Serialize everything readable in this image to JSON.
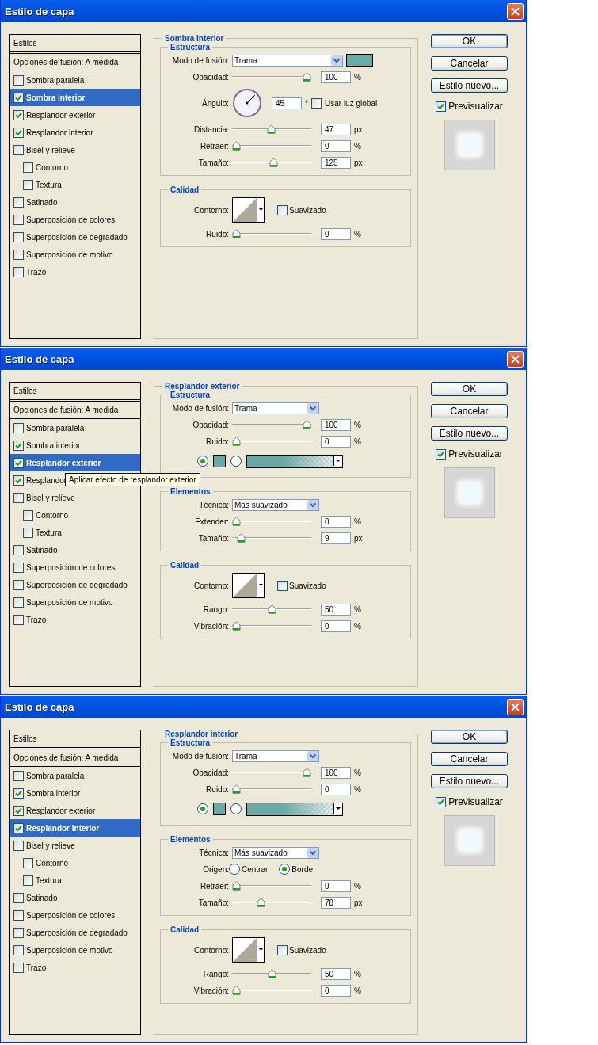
{
  "dialogs": [
    {
      "title": "Estilo de capa",
      "styles_header": "Estilos",
      "blend_options": "Opciones de fusión: A medida",
      "styles": [
        {
          "label": "Sombra paralela",
          "checked": false,
          "selected": false
        },
        {
          "label": "Sombra interior",
          "checked": true,
          "selected": true
        },
        {
          "label": "Resplandor exterior",
          "checked": true,
          "selected": false
        },
        {
          "label": "Resplandor interior",
          "checked": true,
          "selected": false
        },
        {
          "label": "Bisel y relieve",
          "checked": false,
          "selected": false,
          "children": [
            {
              "label": "Contorno",
              "checked": false,
              "selected": false
            },
            {
              "label": "Textura",
              "checked": false,
              "selected": false
            }
          ]
        },
        {
          "label": "Satinado",
          "checked": false,
          "selected": false
        },
        {
          "label": "Superposición de colores",
          "checked": false,
          "selected": false
        },
        {
          "label": "Superposición de degradado",
          "checked": false,
          "selected": false
        },
        {
          "label": "Superposición de motivo",
          "checked": false,
          "selected": false
        },
        {
          "label": "Trazo",
          "checked": false,
          "selected": false
        }
      ],
      "panel": {
        "title": "Sombra interior",
        "groups": [
          {
            "title": "Estructura",
            "rows": [
              {
                "kind": "select",
                "label": "Modo de fusión:",
                "value": "Trama",
                "color": "#6aa9a6"
              },
              {
                "kind": "slider",
                "label": "Opacidad:",
                "level": 1,
                "value": "100",
                "unit": "%"
              },
              {
                "kind": "angle",
                "label": "Ángulo:",
                "value": "45",
                "unit": "°",
                "checkbox": {
                  "label": "Usar luz global",
                  "checked": false
                }
              },
              {
                "kind": "slider",
                "label": "Distancia:",
                "level": 0.49,
                "value": "47",
                "unit": "px"
              },
              {
                "kind": "slider",
                "label": "Retraer:",
                "level": 0,
                "value": "0",
                "unit": "%"
              },
              {
                "kind": "slider",
                "label": "Tamaño:",
                "level": 0.53,
                "value": "125",
                "unit": "px"
              }
            ]
          },
          {
            "title": "Calidad",
            "rows": [
              {
                "kind": "contour",
                "label": "Contorno:",
                "checkbox": {
                  "label": "Suavizado",
                  "checked": false
                }
              },
              {
                "kind": "slider",
                "label": "Ruido:",
                "level": 0,
                "value": "0",
                "unit": "%"
              }
            ]
          }
        ]
      },
      "buttons": [
        {
          "label": "OK",
          "default": true
        },
        {
          "label": "Cancelar",
          "default": false
        },
        {
          "label": "Estilo nuevo...",
          "default": false
        }
      ],
      "preview": {
        "label": "Previsualizar",
        "checked": true
      }
    },
    {
      "title": "Estilo de capa",
      "styles_header": "Estilos",
      "blend_options": "Opciones de fusión: A medida",
      "styles": [
        {
          "label": "Sombra paralela",
          "checked": false,
          "selected": false
        },
        {
          "label": "Sombra interior",
          "checked": true,
          "selected": false
        },
        {
          "label": "Resplandor exterior",
          "checked": true,
          "selected": true
        },
        {
          "label": "Resplandor",
          "checked": true,
          "selected": false,
          "tooltip": "Aplicar efecto de resplandor exterior"
        },
        {
          "label": "Bisel y relieve",
          "checked": false,
          "selected": false,
          "children": [
            {
              "label": "Contorno",
              "checked": false,
              "selected": false
            },
            {
              "label": "Textura",
              "checked": false,
              "selected": false
            }
          ]
        },
        {
          "label": "Satinado",
          "checked": false,
          "selected": false
        },
        {
          "label": "Superposición de colores",
          "checked": false,
          "selected": false
        },
        {
          "label": "Superposición de degradado",
          "checked": false,
          "selected": false
        },
        {
          "label": "Superposición de motivo",
          "checked": false,
          "selected": false
        },
        {
          "label": "Trazo",
          "checked": false,
          "selected": false
        }
      ],
      "panel": {
        "title": "Resplandor exterior",
        "groups": [
          {
            "title": "Estructura",
            "rows": [
              {
                "kind": "select",
                "label": "Modo de fusión:",
                "value": "Trama"
              },
              {
                "kind": "slider",
                "label": "Opacidad:",
                "level": 1,
                "value": "100",
                "unit": "%"
              },
              {
                "kind": "slider",
                "label": "Ruido:",
                "level": 0,
                "value": "0",
                "unit": "%"
              },
              {
                "kind": "fill",
                "options": [
                  {
                    "kind": "solid",
                    "selected": true,
                    "color": "#6aa9a6"
                  },
                  {
                    "kind": "gradient",
                    "selected": false,
                    "color": "#6aa9a6"
                  }
                ]
              }
            ]
          },
          {
            "title": "Elementos",
            "rows": [
              {
                "kind": "select",
                "label": "Técnica:",
                "value": "Más suavizado"
              },
              {
                "kind": "slider",
                "label": "Extender:",
                "level": 0,
                "value": "0",
                "unit": "%"
              },
              {
                "kind": "slider",
                "label": "Tamaño:",
                "level": 0.07,
                "value": "9",
                "unit": "px"
              }
            ]
          },
          {
            "title": "Calidad",
            "rows": [
              {
                "kind": "contour",
                "label": "Contorno:",
                "checkbox": {
                  "label": "Suavizado",
                  "checked": false
                }
              },
              {
                "kind": "slider",
                "label": "Rango:",
                "level": 0.5,
                "value": "50",
                "unit": "%"
              },
              {
                "kind": "slider",
                "label": "Vibración:",
                "level": 0,
                "value": "0",
                "unit": "%"
              }
            ]
          }
        ]
      },
      "buttons": [
        {
          "label": "OK",
          "default": true
        },
        {
          "label": "Cancelar",
          "default": false
        },
        {
          "label": "Estilo nuevo...",
          "default": false
        }
      ],
      "preview": {
        "label": "Previsualizar",
        "checked": true
      }
    },
    {
      "title": "Estilo de capa",
      "styles_header": "Estilos",
      "blend_options": "Opciones de fusión: A medida",
      "styles": [
        {
          "label": "Sombra paralela",
          "checked": false,
          "selected": false
        },
        {
          "label": "Sombra interior",
          "checked": true,
          "selected": false
        },
        {
          "label": "Resplandor exterior",
          "checked": true,
          "selected": false
        },
        {
          "label": "Resplandor interior",
          "checked": true,
          "selected": true
        },
        {
          "label": "Bisel y relieve",
          "checked": false,
          "selected": false,
          "children": [
            {
              "label": "Contorno",
              "checked": false,
              "selected": false
            },
            {
              "label": "Textura",
              "checked": false,
              "selected": false
            }
          ]
        },
        {
          "label": "Satinado",
          "checked": false,
          "selected": false
        },
        {
          "label": "Superposición de colores",
          "checked": false,
          "selected": false
        },
        {
          "label": "Superposición de degradado",
          "checked": false,
          "selected": false
        },
        {
          "label": "Superposición de motivo",
          "checked": false,
          "selected": false
        },
        {
          "label": "Trazo",
          "checked": false,
          "selected": false
        }
      ],
      "panel": {
        "title": "Resplandor interior",
        "groups": [
          {
            "title": "Estructura",
            "rows": [
              {
                "kind": "select",
                "label": "Modo de fusión:",
                "value": "Trama"
              },
              {
                "kind": "slider",
                "label": "Opacidad:",
                "level": 1,
                "value": "100",
                "unit": "%"
              },
              {
                "kind": "slider",
                "label": "Ruido:",
                "level": 0,
                "value": "0",
                "unit": "%"
              },
              {
                "kind": "fill",
                "options": [
                  {
                    "kind": "solid",
                    "selected": true,
                    "color": "#6aa9a6"
                  },
                  {
                    "kind": "gradient",
                    "selected": false,
                    "color": "#6aa9a6"
                  }
                ]
              }
            ]
          },
          {
            "title": "Elementos",
            "rows": [
              {
                "kind": "select",
                "label": "Técnica:",
                "value": "Más suavizado"
              },
              {
                "kind": "radio",
                "label": "Origen:",
                "options": [
                  {
                    "label": "Centrar",
                    "selected": false
                  },
                  {
                    "label": "Borde",
                    "selected": true
                  }
                ]
              },
              {
                "kind": "slider",
                "label": "Retraer:",
                "level": 0,
                "value": "0",
                "unit": "%"
              },
              {
                "kind": "slider",
                "label": "Tamaño:",
                "level": 0.35,
                "value": "78",
                "unit": "px"
              }
            ]
          },
          {
            "title": "Calidad",
            "rows": [
              {
                "kind": "contour",
                "label": "Contorno:",
                "checkbox": {
                  "label": "Suavizado",
                  "checked": false
                }
              },
              {
                "kind": "slider",
                "label": "Rango:",
                "level": 0.5,
                "value": "50",
                "unit": "%"
              },
              {
                "kind": "slider",
                "label": "Vibración:",
                "level": 0,
                "value": "0",
                "unit": "%"
              }
            ]
          }
        ]
      },
      "buttons": [
        {
          "label": "OK",
          "default": true
        },
        {
          "label": "Cancelar",
          "default": false
        },
        {
          "label": "Estilo nuevo...",
          "default": false
        }
      ],
      "preview": {
        "label": "Previsualizar",
        "checked": true
      }
    }
  ]
}
